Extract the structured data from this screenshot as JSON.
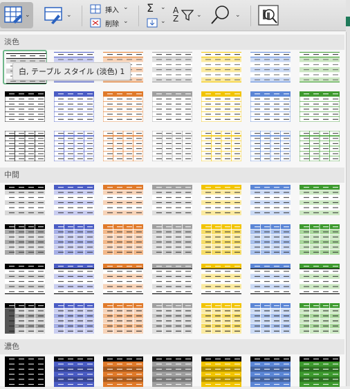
{
  "toolbar": {
    "insert_label": "挿入",
    "delete_label": "削除",
    "sum_symbol": "Σ",
    "sort_label": "A\nZ",
    "icons": [
      "format-as-table-icon",
      "cell-styles-icon",
      "insert-cells-icon",
      "delete-cells-icon",
      "autosum-icon",
      "fill-icon",
      "sort-filter-icon",
      "find-icon",
      "sensitivity-icon"
    ]
  },
  "tooltip": "白, テーブル スタイル (淡色) 1",
  "sections": [
    {
      "name": "淡色",
      "rows": 3
    },
    {
      "name": "中間",
      "rows": 4
    },
    {
      "name": "濃色",
      "rows": 1
    }
  ],
  "colors": {
    "black": "#000000",
    "blue": "#4a5cc4",
    "orange": "#e07a2a",
    "gray": "#a0a0a0",
    "yellow": "#f2c400",
    "lightblue": "#5b86d6",
    "green": "#3d9a2e"
  },
  "palette_order": [
    "black",
    "blue",
    "orange",
    "gray",
    "yellow",
    "lightblue",
    "green"
  ]
}
